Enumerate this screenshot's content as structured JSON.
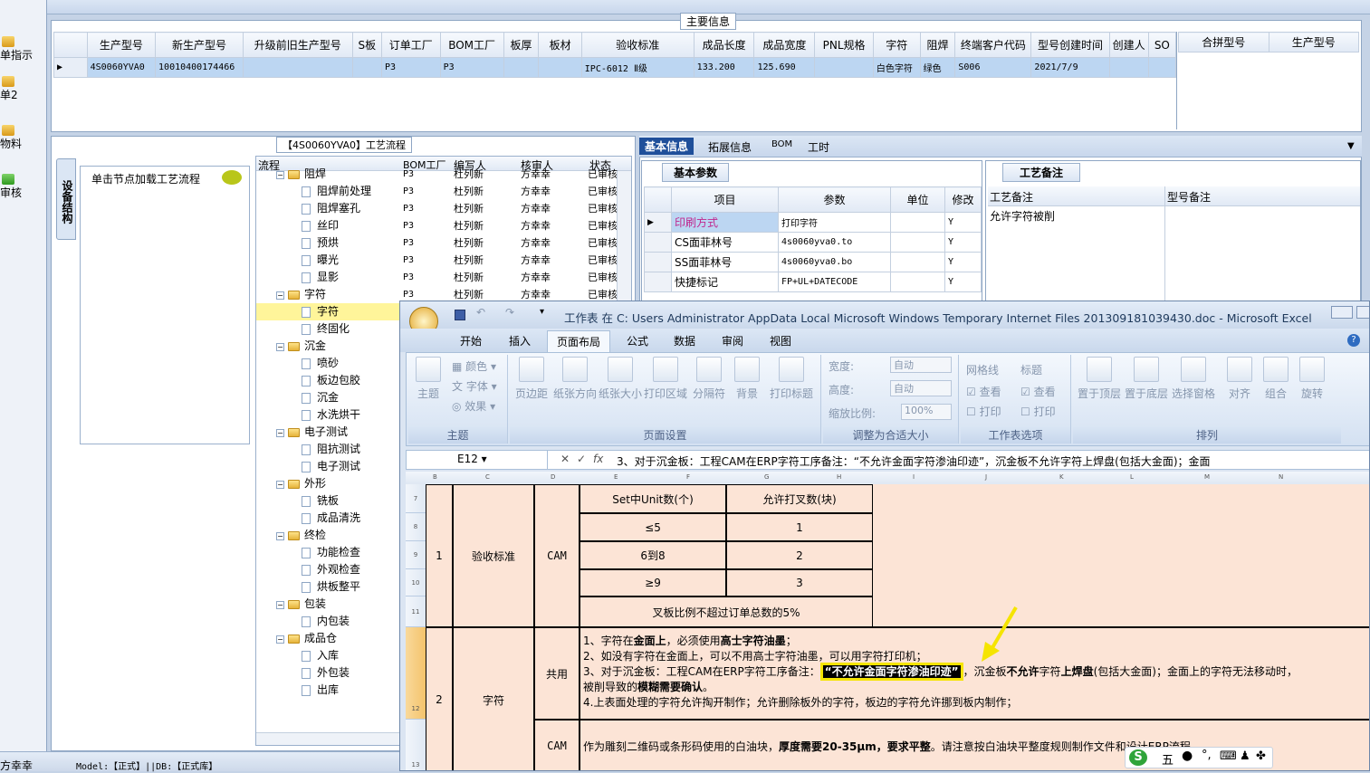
{
  "left_nav": {
    "items": [
      "单指示",
      "单2",
      "物料",
      "审核"
    ]
  },
  "main_info": {
    "group_title": "主要信息",
    "columns": [
      "生产型号",
      "新生产型号",
      "升级前旧生产型号",
      "S板",
      "订单工厂",
      "BOM工厂",
      "板厚",
      "板材",
      "验收标准",
      "成品长度",
      "成品宽度",
      "PNL规格",
      "字符",
      "阻焊",
      "终端客户代码",
      "型号创建时间",
      "创建人",
      "SO"
    ],
    "row": [
      "4S0060YVA0",
      "10010400174466",
      "",
      "",
      "P3",
      "P3",
      "",
      "",
      "IPC-6012 Ⅱ级",
      "133.200",
      "125.690",
      "",
      "白色字符",
      "绿色",
      "S006",
      "2021/7/9",
      "",
      ""
    ],
    "side_columns": [
      "合拼型号",
      "生产型号"
    ]
  },
  "process": {
    "group_title": "【4S0060YVA0】工艺流程",
    "vertical_tab": "设备结构",
    "hint": "单击节点加载工艺流程",
    "columns": [
      "流程",
      "BOM工厂",
      "编写人",
      "核审人",
      "状态"
    ],
    "rows": [
      {
        "level": 1,
        "name": "阻焊",
        "factory": "P3",
        "writer": "杜列新",
        "reviewer": "方幸幸",
        "status": "已审核"
      },
      {
        "level": 2,
        "name": "阻焊前处理",
        "factory": "P3",
        "writer": "杜列新",
        "reviewer": "方幸幸",
        "status": "已审核"
      },
      {
        "level": 2,
        "name": "阻焊塞孔",
        "factory": "P3",
        "writer": "杜列新",
        "reviewer": "方幸幸",
        "status": "已审核"
      },
      {
        "level": 2,
        "name": "丝印",
        "factory": "P3",
        "writer": "杜列新",
        "reviewer": "方幸幸",
        "status": "已审核"
      },
      {
        "level": 2,
        "name": "预烘",
        "factory": "P3",
        "writer": "杜列新",
        "reviewer": "方幸幸",
        "status": "已审核"
      },
      {
        "level": 2,
        "name": "曝光",
        "factory": "P3",
        "writer": "杜列新",
        "reviewer": "方幸幸",
        "status": "已审核"
      },
      {
        "level": 2,
        "name": "显影",
        "factory": "P3",
        "writer": "杜列新",
        "reviewer": "方幸幸",
        "status": "已审核"
      },
      {
        "level": 1,
        "name": "字符",
        "factory": "P3",
        "writer": "杜列新",
        "reviewer": "方幸幸",
        "status": "已审核"
      },
      {
        "level": 2,
        "name": "字符",
        "factory": "",
        "writer": "",
        "reviewer": "",
        "status": ""
      },
      {
        "level": 2,
        "name": "终固化",
        "factory": "",
        "writer": "",
        "reviewer": "",
        "status": ""
      },
      {
        "level": 1,
        "name": "沉金",
        "factory": "",
        "writer": "",
        "reviewer": "",
        "status": ""
      },
      {
        "level": 2,
        "name": "喷砂",
        "factory": "",
        "writer": "",
        "reviewer": "",
        "status": ""
      },
      {
        "level": 2,
        "name": "板边包胶",
        "factory": "",
        "writer": "",
        "reviewer": "",
        "status": ""
      },
      {
        "level": 2,
        "name": "沉金",
        "factory": "",
        "writer": "",
        "reviewer": "",
        "status": ""
      },
      {
        "level": 2,
        "name": "水洗烘干",
        "factory": "",
        "writer": "",
        "reviewer": "",
        "status": ""
      },
      {
        "level": 1,
        "name": "电子测试",
        "factory": "",
        "writer": "",
        "reviewer": "",
        "status": ""
      },
      {
        "level": 2,
        "name": "阻抗测试",
        "factory": "",
        "writer": "",
        "reviewer": "",
        "status": ""
      },
      {
        "level": 2,
        "name": "电子测试",
        "factory": "",
        "writer": "",
        "reviewer": "",
        "status": ""
      },
      {
        "level": 1,
        "name": "外形",
        "factory": "",
        "writer": "",
        "reviewer": "",
        "status": ""
      },
      {
        "level": 2,
        "name": "铣板",
        "factory": "",
        "writer": "",
        "reviewer": "",
        "status": ""
      },
      {
        "level": 2,
        "name": "成品清洗",
        "factory": "",
        "writer": "",
        "reviewer": "",
        "status": ""
      },
      {
        "level": 1,
        "name": "终检",
        "factory": "",
        "writer": "",
        "reviewer": "",
        "status": ""
      },
      {
        "level": 2,
        "name": "功能检查",
        "factory": "",
        "writer": "",
        "reviewer": "",
        "status": ""
      },
      {
        "level": 2,
        "name": "外观检查",
        "factory": "",
        "writer": "",
        "reviewer": "",
        "status": ""
      },
      {
        "level": 2,
        "name": "烘板整平",
        "factory": "",
        "writer": "",
        "reviewer": "",
        "status": ""
      },
      {
        "level": 1,
        "name": "包装",
        "factory": "",
        "writer": "",
        "reviewer": "",
        "status": ""
      },
      {
        "level": 2,
        "name": "内包装",
        "factory": "",
        "writer": "",
        "reviewer": "",
        "status": ""
      },
      {
        "level": 1,
        "name": "成品仓",
        "factory": "",
        "writer": "",
        "reviewer": "",
        "status": ""
      },
      {
        "level": 2,
        "name": "入库",
        "factory": "",
        "writer": "",
        "reviewer": "",
        "status": ""
      },
      {
        "level": 2,
        "name": "外包装",
        "factory": "",
        "writer": "",
        "reviewer": "",
        "status": ""
      },
      {
        "level": 2,
        "name": "出库",
        "factory": "",
        "writer": "",
        "reviewer": "",
        "status": ""
      }
    ]
  },
  "right_panel": {
    "tabs": [
      "基本信息",
      "拓展信息",
      "BOM",
      "工时"
    ],
    "basic_group": "基本参数",
    "basic_columns": [
      "项目",
      "参数",
      "单位",
      "修改"
    ],
    "basic_rows": [
      [
        "印刷方式",
        "打印字符",
        "",
        "Y"
      ],
      [
        "CS面菲林号",
        "4s0060yva0.to",
        "",
        "Y"
      ],
      [
        "SS面菲林号",
        "4s0060yva0.bo",
        "",
        "Y"
      ],
      [
        "快捷标记",
        "FP+UL+DATECODE",
        "",
        "Y"
      ]
    ],
    "notes_group": "工艺备注",
    "notes_columns": [
      "工艺备注",
      "型号备注"
    ],
    "process_note": "允许字符被削"
  },
  "status_bar": {
    "user": "方幸幸",
    "model_info": "Model:【正式】||DB:【正式库】"
  },
  "excel": {
    "title": "工作表 在 C: Users Administrator AppData Local Microsoft Windows Temporary Internet Files 201309181039430.doc - Microsoft Excel",
    "tabs": [
      "开始",
      "插入",
      "页面布局",
      "公式",
      "数据",
      "审阅",
      "视图"
    ],
    "active_tab": "页面布局",
    "ribbon": {
      "theme_group": {
        "label": "主题",
        "main": "主题",
        "colors": "颜色",
        "fonts": "字体",
        "effects": "效果"
      },
      "page_setup_group": {
        "label": "页面设置",
        "buttons": [
          "页边距",
          "纸张方向",
          "纸张大小",
          "打印区域",
          "分隔符",
          "背景",
          "打印标题"
        ]
      },
      "scale_group": {
        "label": "调整为合适大小",
        "width_label": "宽度:",
        "width_value": "自动",
        "height_label": "高度:",
        "height_value": "自动",
        "scale_label": "缩放比例:",
        "scale_value": "100%"
      },
      "sheet_options_group": {
        "label": "工作表选项",
        "gridlines": "网格线",
        "headings": "标题",
        "view": "查看",
        "print": "打印"
      },
      "arrange_group": {
        "label": "排列",
        "buttons": [
          "置于顶层",
          "置于底层",
          "选择窗格",
          "对齐",
          "组合",
          "旋转"
        ]
      }
    },
    "name_box": "E12",
    "formula": "3、对于沉金板：工程CAM在ERP字符工序备注：“不允许金面字符渗油印迹”，沉金板不允许字符上焊盘(包括大金面)；金面",
    "col_letters": [
      "B",
      "C",
      "D",
      "E",
      "F",
      "G",
      "H",
      "I",
      "J",
      "K",
      "L",
      "M",
      "N"
    ],
    "row_numbers": [
      "7",
      "8",
      "9",
      "10",
      "11",
      "12",
      "13"
    ],
    "row1": {
      "no": "1",
      "item": "验收标准",
      "dept": "CAM"
    },
    "set_table": {
      "h1": "Set中Unit数(个)",
      "h2": "允许打叉数(块)",
      "rows": [
        [
          "≤5",
          "1"
        ],
        [
          "6到8",
          "2"
        ],
        [
          "≥9",
          "3"
        ]
      ],
      "note": "叉板比例不超过订单总数的5%"
    },
    "row2": {
      "no": "2",
      "item": "字符",
      "dept1": "共用",
      "dept2": "CAM"
    },
    "common_lines": {
      "l1a": "1、字符在",
      "l1b": "金面上",
      "l1c": "，必须使用",
      "l1d": "高士字符油墨",
      "l1e": "；",
      "l2": "2、如没有字符在金面上，可以不用高士字符油墨，可以用字符打印机；",
      "l3a": "3、对于沉金板：工程CAM在ERP字符工序备注：",
      "l3h": "“不允许金面字符渗油印迹”",
      "l3b": "，沉金板",
      "l3c": "不允许",
      "l3d": "字符",
      "l3e": "上焊盘",
      "l3f": "(包括大金面)；金面上的字符无法移动时，",
      "l3g": "被削导致的",
      "l3i": "模糊需要确认",
      "l3j": "。",
      "l4": "4.上表面处理的字符允许掏开制作；允许删除板外的字符，板边的字符允许挪到板内制作；"
    },
    "cam_line_a": "作为雕刻二维码或条形码使用的白油块，",
    "cam_line_b": "厚度需要20-35μm，要求平整",
    "cam_line_c": "。请注意按白油块平整度规则制作文件和设计ERP流程。"
  },
  "ime": {
    "label": "五"
  }
}
